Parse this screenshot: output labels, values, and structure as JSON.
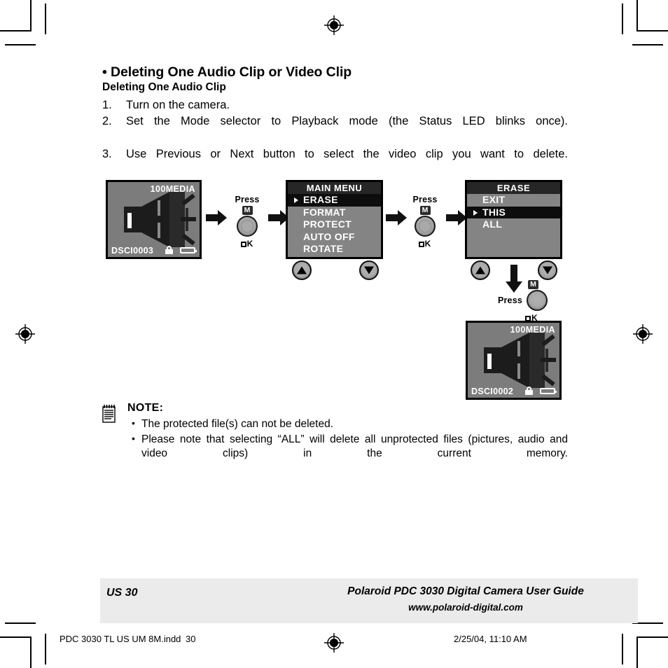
{
  "page": {
    "section_title": "• Deleting One Audio Clip or Video Clip",
    "sub_title": "Deleting One Audio Clip",
    "steps": [
      {
        "num": "1.",
        "text": "Turn on the camera."
      },
      {
        "num": "2.",
        "text": "Set the Mode selector to Playback mode (the Status LED blinks once)."
      },
      {
        "num": "3.",
        "text": "Use Previous or Next button to select the video clip you want to delete."
      }
    ]
  },
  "diagram": {
    "screen_before": {
      "folder": "100MEDIA",
      "filename": "DSCI0003",
      "lock_icon": "lock-icon",
      "battery_icon": "battery-icon",
      "content_icon": "audio-speaker-icon"
    },
    "screen_after": {
      "folder": "100MEDIA",
      "filename": "DSCI0002",
      "lock_icon": "lock-icon",
      "battery_icon": "battery-icon",
      "content_icon": "audio-speaker-icon"
    },
    "main_menu": {
      "title": "MAIN MENU",
      "items": [
        {
          "label": "ERASE",
          "selected": true
        },
        {
          "label": "FORMAT",
          "selected": false
        },
        {
          "label": "PROTECT",
          "selected": false
        },
        {
          "label": "AUTO OFF",
          "selected": false
        },
        {
          "label": "ROTATE",
          "selected": false
        }
      ]
    },
    "erase_menu": {
      "title": "ERASE",
      "items": [
        {
          "label": "EXIT",
          "selected": false
        },
        {
          "label": "THIS",
          "selected": true
        },
        {
          "label": "ALL",
          "selected": false
        }
      ]
    },
    "press_groups": [
      {
        "press_label": "Press",
        "badge": "M",
        "ok_label": "OK"
      },
      {
        "press_label": "Press",
        "badge": "M",
        "ok_label": "OK"
      },
      {
        "press_label": "Press",
        "badge": "M",
        "ok_label": "OK"
      }
    ],
    "nav_buttons": {
      "up_icon": "triangle-up-icon",
      "down_icon": "triangle-down-icon"
    },
    "flow_arrows": {
      "right_icon": "arrow-right-icon",
      "down_icon": "arrow-down-icon"
    }
  },
  "note": {
    "icon": "notepad-icon",
    "heading": "NOTE:",
    "items": [
      "The protected file(s) can not be deleted.",
      "Please note that selecting “ALL” will delete all unprotected files (pictures, audio and video clips) in the current memory."
    ]
  },
  "footer": {
    "page_label": "US 30",
    "guide_title": "Polaroid PDC 3030 Digital Camera User Guide",
    "url": "www.polaroid-digital.com",
    "print_filename": "PDC 3030 TL US UM 8M.indd",
    "print_page": "30",
    "print_date": "2/25/04, 11:10 AM"
  },
  "marks": {
    "registration_icon": "registration-target-icon",
    "crop_icon": "crop-mark"
  }
}
